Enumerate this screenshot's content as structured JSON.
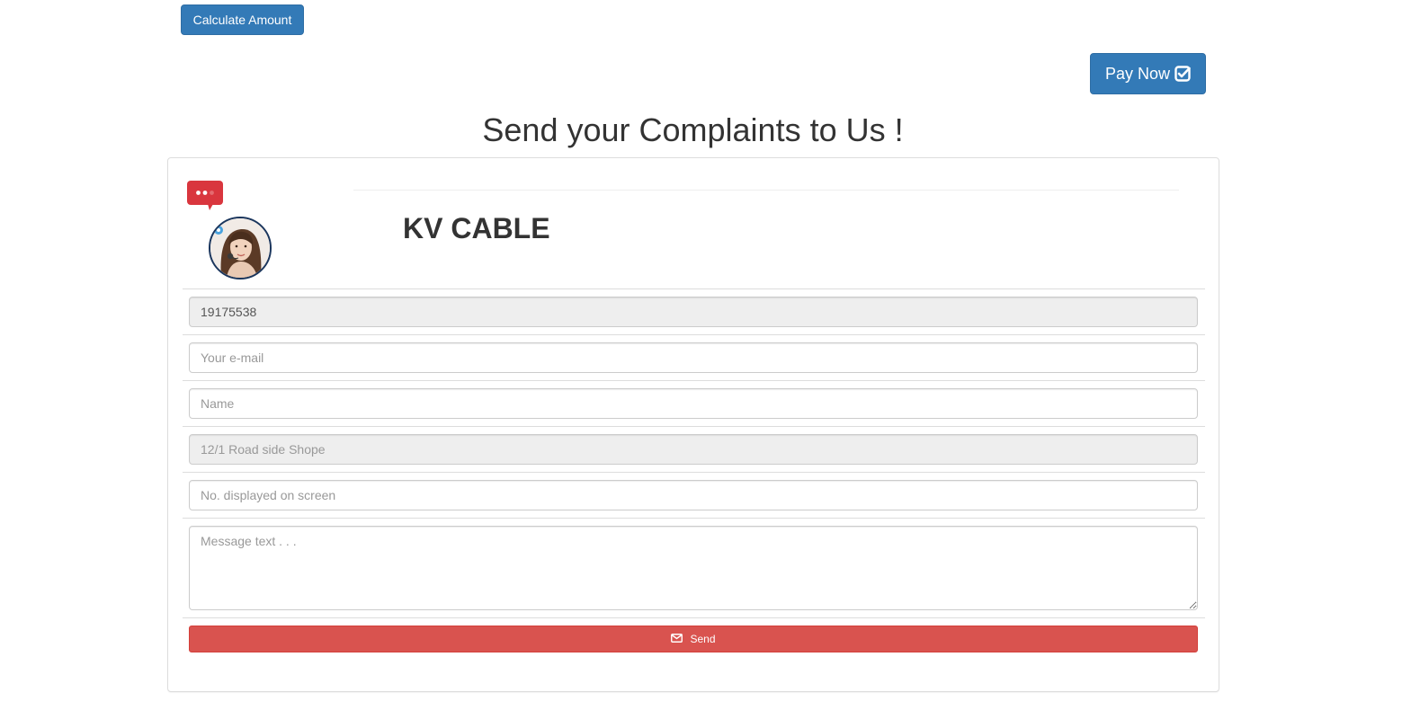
{
  "toolbar": {
    "calculate_label": "Calculate Amount",
    "pay_label": "Pay Now",
    "pay_icon": "check-square-icon"
  },
  "page": {
    "title": "Send your Complaints to Us !"
  },
  "panel": {
    "brand": "KV CABLE",
    "chat_icon": "chat-bubble-icon",
    "avatar": "support-agent-avatar"
  },
  "form": {
    "customer_id": {
      "value": "19175538"
    },
    "email": {
      "placeholder": "Your e-mail"
    },
    "name": {
      "placeholder": "Name"
    },
    "address": {
      "placeholder": "12/1 Road side Shope"
    },
    "screen_number": {
      "placeholder": "No. displayed on screen"
    },
    "message": {
      "placeholder": "Message text . . ."
    },
    "send_label": "Send",
    "send_icon": "envelope-icon"
  },
  "colors": {
    "primary": "#337ab7",
    "danger": "#d9534f",
    "chat_badge": "#d9363e"
  }
}
